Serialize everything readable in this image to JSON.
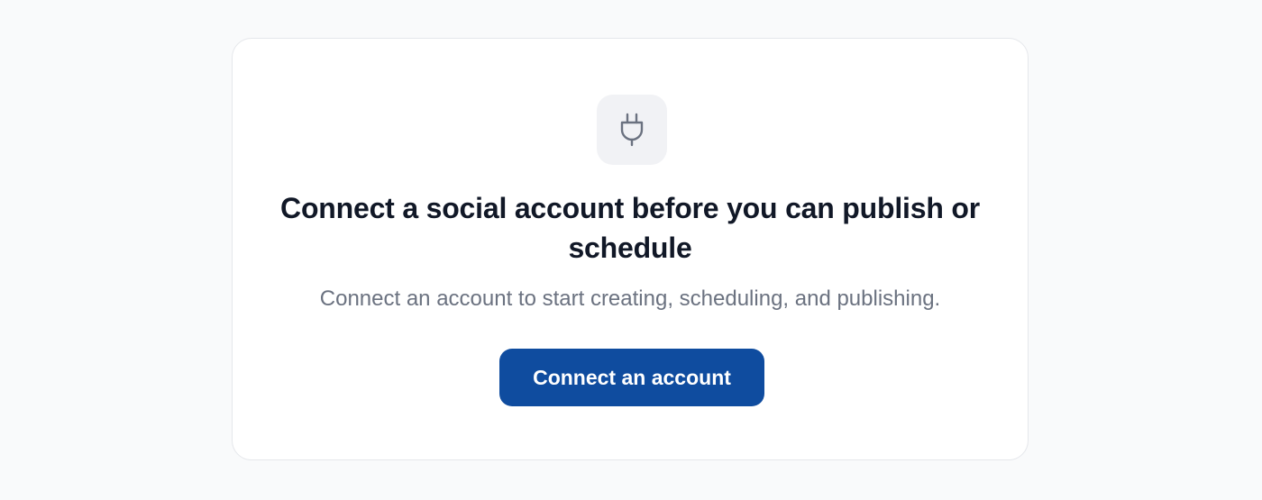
{
  "empty_state": {
    "icon": "plug-icon",
    "title": "Connect a social account before you can publish or schedule",
    "subtitle": "Connect an account to start creating, scheduling, and publishing.",
    "cta_label": "Connect an account"
  },
  "colors": {
    "page_background": "#f9fafb",
    "card_background": "#ffffff",
    "title": "#111827",
    "subtitle": "#6b7280",
    "button_background": "#0f4c9f",
    "button_text": "#ffffff",
    "icon_tile": "#f1f2f5",
    "icon_stroke": "#6b7280"
  }
}
